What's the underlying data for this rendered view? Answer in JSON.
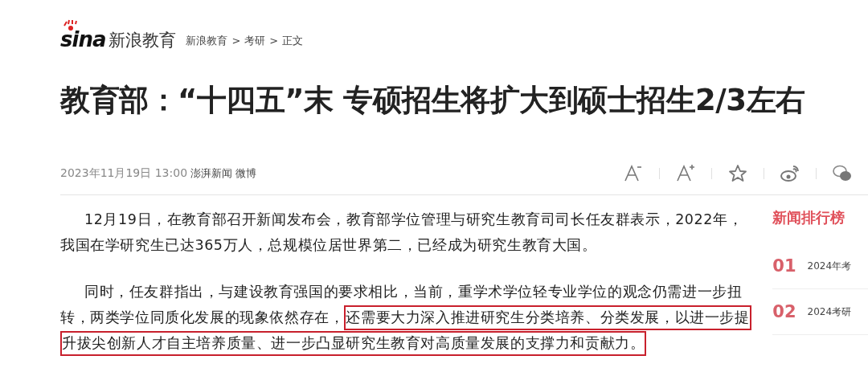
{
  "header": {
    "logo_text": "sina",
    "site_name": "新浪教育",
    "breadcrumb": [
      "新浪教育",
      "考研",
      "正文"
    ],
    "separator": ">"
  },
  "article": {
    "title": "教育部：“十四五”末 专硕招生将扩大到硕士招生2/3左右",
    "date": "2023年11月19日 13:00",
    "source": "澎湃新闻",
    "source_link": "微博",
    "tools": [
      {
        "kind": "font-smaller"
      },
      {
        "kind": "font-larger"
      },
      {
        "kind": "favorite"
      },
      {
        "kind": "weibo"
      },
      {
        "kind": "wechat"
      }
    ],
    "paragraphs": [
      {
        "text": "12月19日，在教育部召开新闻发布会，教育部学位管理与研究生教育司司长任友群表示，2022年，我国在学研究生已达365万人，总规模位居世界第二，已经成为研究生教育大国。"
      },
      {
        "text": "同时，任友群指出，与建设教育强国的要求相比，当前，重学术学位轻专业学位的观念仍需进一步扭转，两类学位同质化发展的现象依然存在，",
        "highlight": "还需要大力深入推进研究生分类培养、分类发展，以进一步提升拔尖创新人才自主培养质量、进一步凸显研究生教育对高质量发展的支撑力和贡献力。"
      }
    ]
  },
  "ranking": {
    "title": "新闻排行榜",
    "items": [
      {
        "rank": "01",
        "text": "2024年考"
      },
      {
        "rank": "02",
        "text": "2024考研"
      }
    ]
  }
}
